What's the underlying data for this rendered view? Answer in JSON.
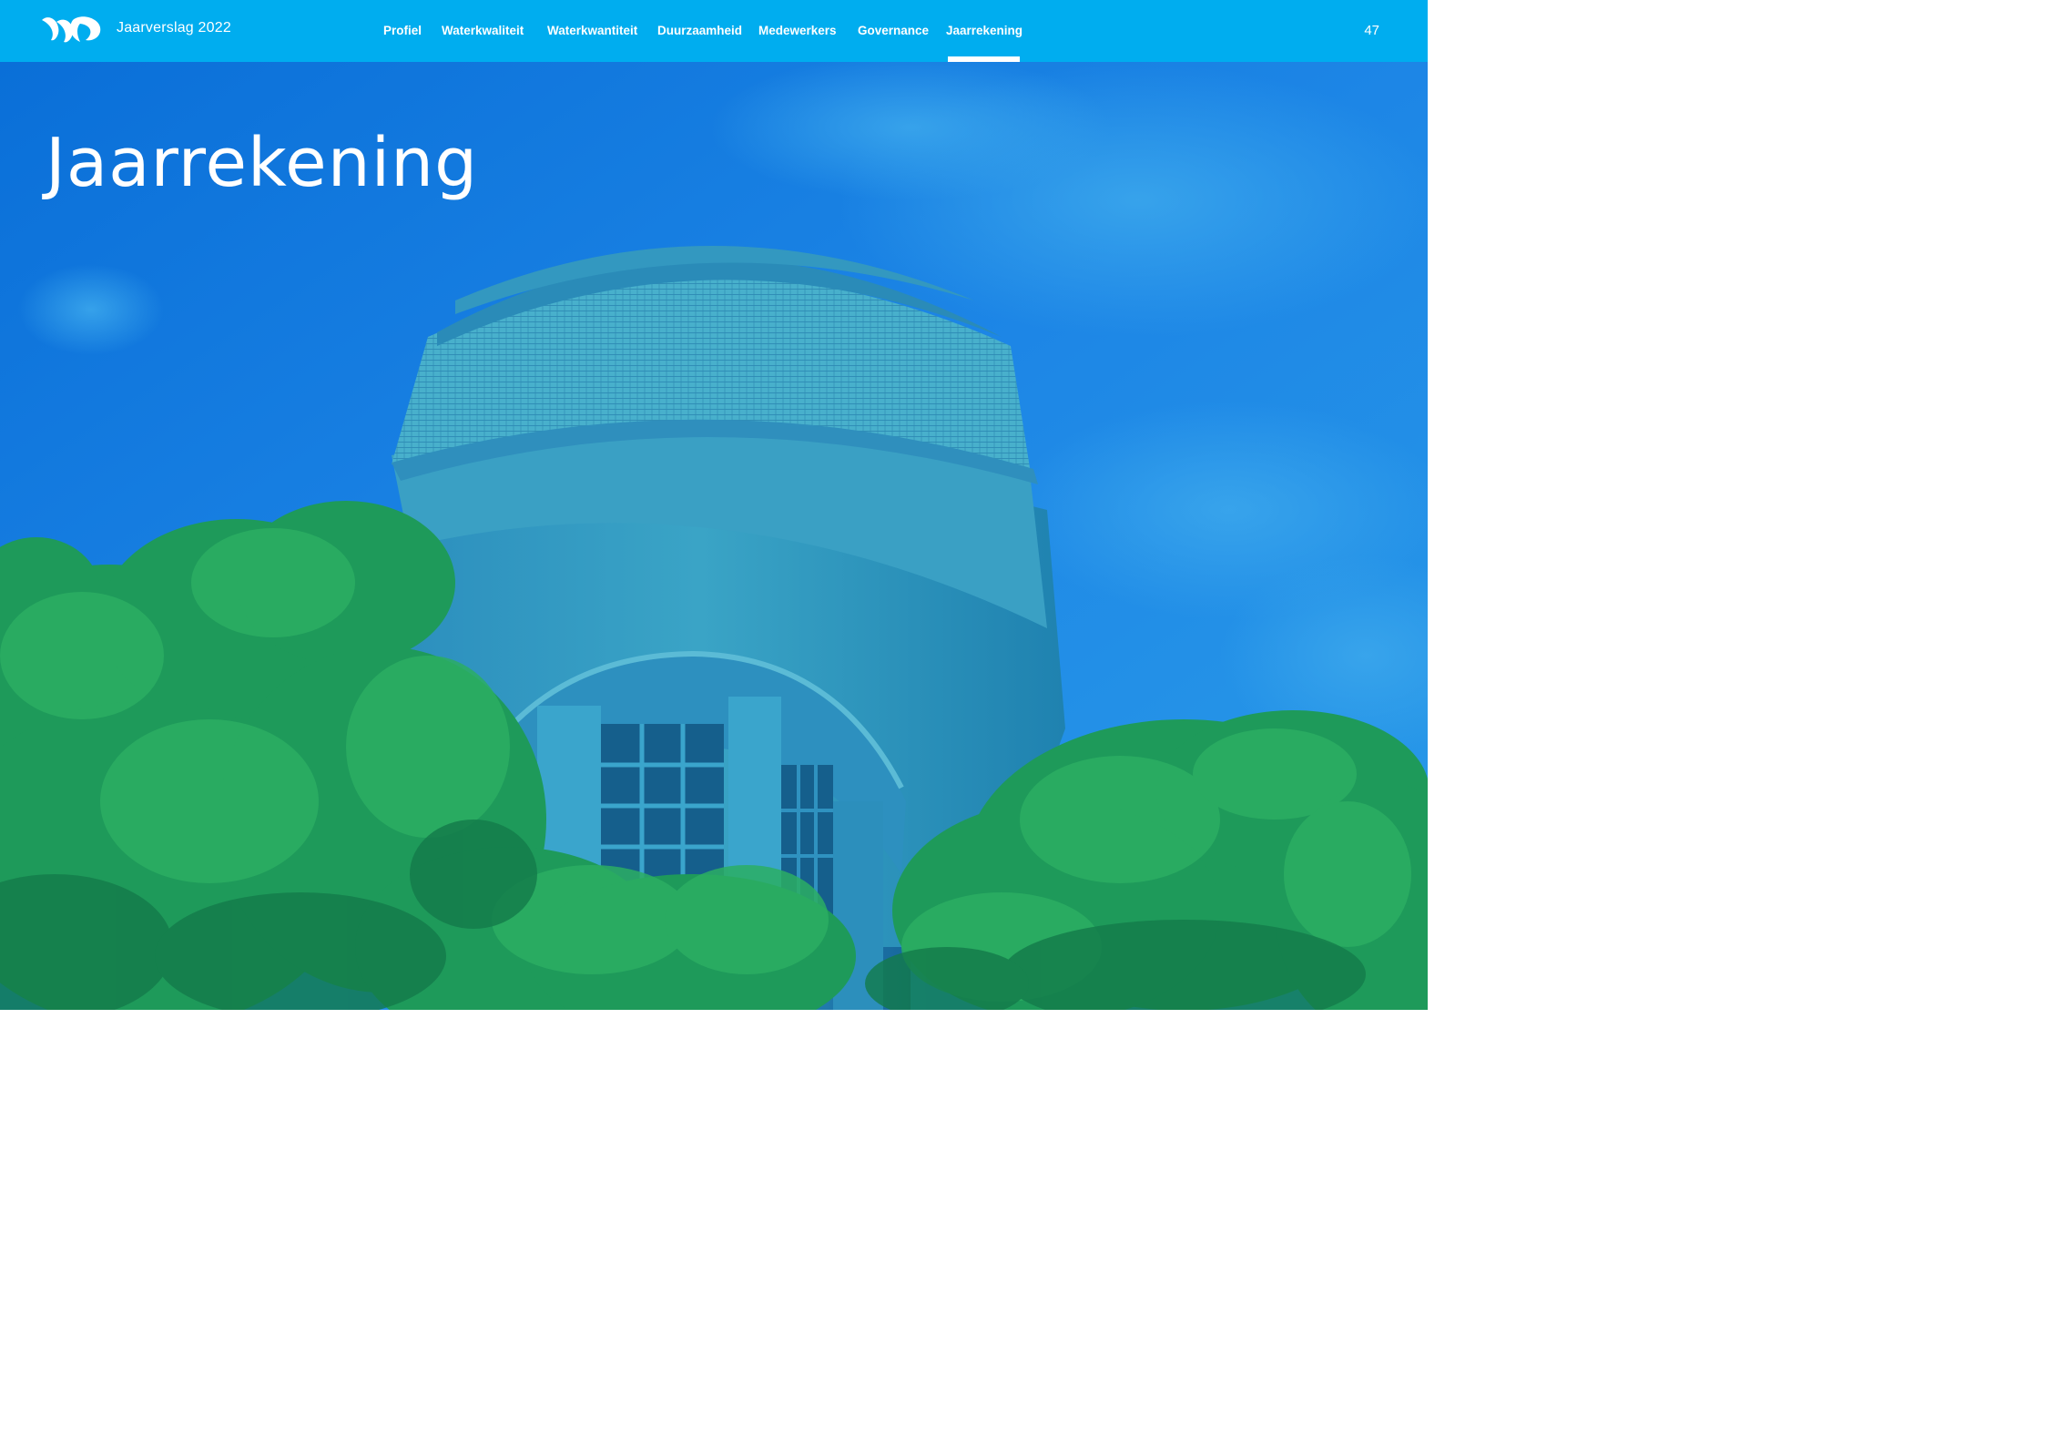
{
  "header": {
    "report_title": "Jaarverslag 2022",
    "page_number": "47",
    "logo_icon": "water-drops-logo",
    "nav": [
      {
        "label": "Profiel"
      },
      {
        "label": "Waterkwaliteit"
      },
      {
        "label": "Waterkwantiteit"
      },
      {
        "label": "Duurzaamheid"
      },
      {
        "label": "Medewerkers"
      },
      {
        "label": "Governance"
      },
      {
        "label": "Jaarrekening",
        "active": true
      }
    ]
  },
  "hero": {
    "title": "Jaarrekening",
    "image_subject": "water-tower-photo"
  },
  "colors": {
    "header_bg": "#00adef",
    "sky": "#1a7fe0",
    "text": "#ffffff"
  }
}
